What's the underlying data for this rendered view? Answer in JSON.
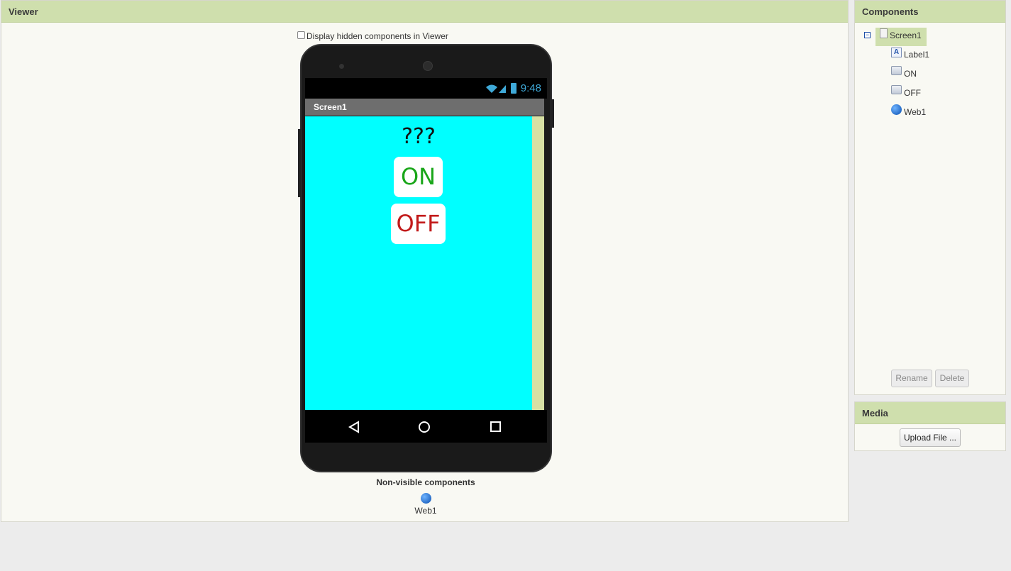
{
  "viewer": {
    "header": "Viewer",
    "hidden_toggle_label": "Display hidden components in Viewer",
    "phone": {
      "status_time": "9:48",
      "title": "Screen1",
      "label1_text": "???",
      "on_button": "ON",
      "off_button": "OFF",
      "screen_color": "#00ffff"
    },
    "nonvisible_title": "Non-visible components",
    "nonvisible_items": [
      "Web1"
    ]
  },
  "components": {
    "header": "Components",
    "root": "Screen1",
    "items": [
      {
        "label": "Label1",
        "icon": "label-icon"
      },
      {
        "label": "ON",
        "icon": "button-icon"
      },
      {
        "label": "OFF",
        "icon": "button-icon"
      },
      {
        "label": "Web1",
        "icon": "web-icon"
      }
    ],
    "rename_label": "Rename",
    "delete_label": "Delete"
  },
  "media": {
    "header": "Media",
    "upload_label": "Upload File ..."
  },
  "colors": {
    "header_bg": "#cfdfad",
    "panel_bg": "#f9f9f3",
    "on_text": "#19a619",
    "off_text": "#c21a1a"
  }
}
